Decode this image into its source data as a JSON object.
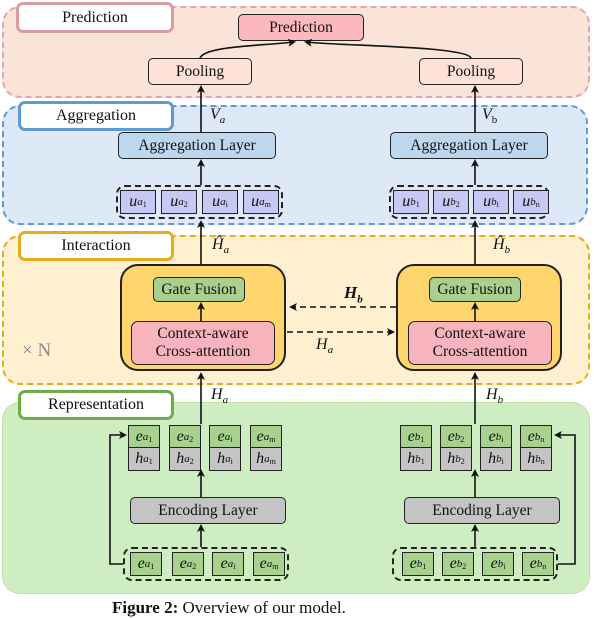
{
  "sections": {
    "prediction": "Prediction",
    "aggregation": "Aggregation",
    "interaction": "Interaction",
    "representation": "Representation"
  },
  "prediction_block": {
    "output_label": "Prediction",
    "pooling_left": "Pooling",
    "pooling_right": "Pooling"
  },
  "aggregation_block": {
    "layer_left": "Aggregation Layer",
    "layer_right": "Aggregation Layer",
    "v_left": {
      "base": "V",
      "sub": "a"
    },
    "v_right": {
      "base": "V",
      "sub": "b"
    },
    "u_left": [
      {
        "base": "u",
        "sub": "a",
        "subsub": "1"
      },
      {
        "base": "u",
        "sub": "a",
        "subsub": "2"
      },
      {
        "base": "u",
        "sub": "a",
        "subsub": "i"
      },
      {
        "base": "u",
        "sub": "a",
        "subsub": "m"
      }
    ],
    "u_right": [
      {
        "base": "u",
        "sub": "b",
        "subsub": "1"
      },
      {
        "base": "u",
        "sub": "b",
        "subsub": "2"
      },
      {
        "base": "u",
        "sub": "b",
        "subsub": "i"
      },
      {
        "base": "u",
        "sub": "b",
        "subsub": "n"
      }
    ]
  },
  "interaction_block": {
    "gate_fusion": "Gate Fusion",
    "cross_attention_line1": "Context-aware",
    "cross_attention_line2": "Cross-attention",
    "repeat": "× N",
    "h_hat_left": {
      "base": "Ĥ",
      "sub": "a"
    },
    "h_hat_right": {
      "base": "Ĥ",
      "sub": "b"
    },
    "h_b_label": {
      "base": "H",
      "sub": "b"
    },
    "h_a_label": {
      "base": "H",
      "sub": "a"
    }
  },
  "representation_block": {
    "encoding_left": "Encoding Layer",
    "encoding_right": "Encoding Layer",
    "h_left": {
      "base": "H",
      "sub": "a"
    },
    "h_right": {
      "base": "H",
      "sub": "b"
    },
    "stack_left": [
      {
        "e": {
          "base": "e",
          "sub": "a",
          "subsub": "1"
        },
        "h": {
          "base": "h",
          "sub": "a",
          "subsub": "1"
        }
      },
      {
        "e": {
          "base": "e",
          "sub": "a",
          "subsub": "2"
        },
        "h": {
          "base": "h",
          "sub": "a",
          "subsub": "2"
        }
      },
      {
        "e": {
          "base": "e",
          "sub": "a",
          "subsub": "i"
        },
        "h": {
          "base": "h",
          "sub": "a",
          "subsub": "i"
        }
      },
      {
        "e": {
          "base": "e",
          "sub": "a",
          "subsub": "m"
        },
        "h": {
          "base": "h",
          "sub": "a",
          "subsub": "m"
        }
      }
    ],
    "stack_right": [
      {
        "e": {
          "base": "e",
          "sub": "b",
          "subsub": "1"
        },
        "h": {
          "base": "h",
          "sub": "b",
          "subsub": "1"
        }
      },
      {
        "e": {
          "base": "e",
          "sub": "b",
          "subsub": "2"
        },
        "h": {
          "base": "h",
          "sub": "b",
          "subsub": "2"
        }
      },
      {
        "e": {
          "base": "e",
          "sub": "b",
          "subsub": "i"
        },
        "h": {
          "base": "h",
          "sub": "b",
          "subsub": "i"
        }
      },
      {
        "e": {
          "base": "e",
          "sub": "b",
          "subsub": "n"
        },
        "h": {
          "base": "h",
          "sub": "b",
          "subsub": "n"
        }
      }
    ],
    "input_left": [
      {
        "base": "e",
        "sub": "a",
        "subsub": "1"
      },
      {
        "base": "e",
        "sub": "a",
        "subsub": "2"
      },
      {
        "base": "e",
        "sub": "a",
        "subsub": "i"
      },
      {
        "base": "e",
        "sub": "a",
        "subsub": "m"
      }
    ],
    "input_right": [
      {
        "base": "e",
        "sub": "b",
        "subsub": "1"
      },
      {
        "base": "e",
        "sub": "b",
        "subsub": "2"
      },
      {
        "base": "e",
        "sub": "b",
        "subsub": "i"
      },
      {
        "base": "e",
        "sub": "b",
        "subsub": "n"
      }
    ]
  },
  "caption": {
    "label": "Figure 2:",
    "text": "Overview of our model."
  }
}
